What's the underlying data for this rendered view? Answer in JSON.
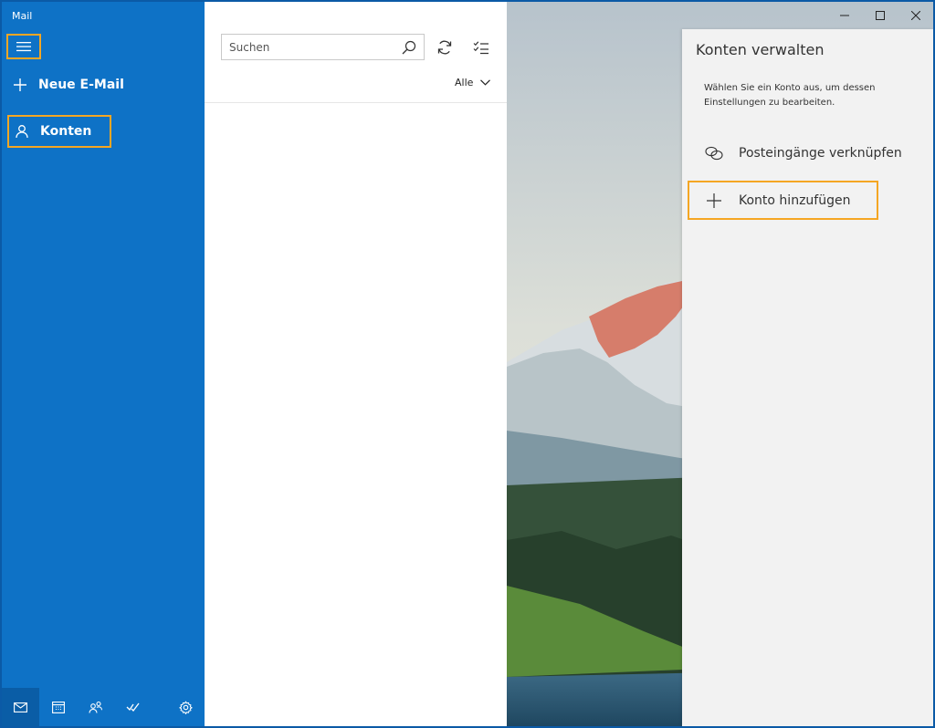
{
  "app": {
    "title": "Mail"
  },
  "nav": {
    "menu_icon": "hamburger-icon",
    "new_mail_label": "Neue E-Mail",
    "accounts_label": "Konten",
    "bottom_icons": [
      "mail-icon",
      "calendar-icon",
      "people-icon",
      "todo-icon",
      "settings-icon"
    ]
  },
  "list": {
    "search_placeholder": "Suchen",
    "filter_label": "Alle"
  },
  "flyout": {
    "title": "Konten verwalten",
    "description": "Wählen Sie ein Konto aus, um dessen Einstellungen zu bearbeiten.",
    "link_inboxes_label": "Posteingänge verknüpfen",
    "add_account_label": "Konto hinzufügen"
  },
  "colors": {
    "nav_blue": "#0e72c6",
    "highlight": "#f5a623",
    "flyout_bg": "#f2f2f2"
  }
}
